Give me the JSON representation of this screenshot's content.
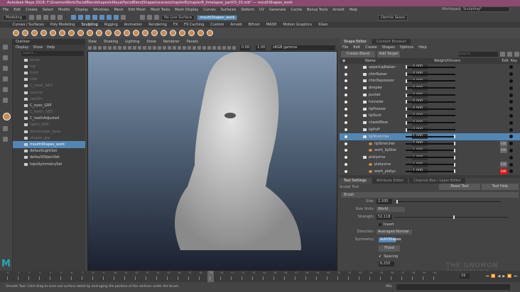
{
  "title": "Autodesk Maya 2018: F:\\GnomonWork\\FacialBlendshapesInMaya\\FacialBlendShapes\\scenes\\chapter8\\chapter8_timelapse_part03_03.mb* --- mouthShapes_work",
  "menu": [
    "File",
    "Edit",
    "Create",
    "Select",
    "Modify",
    "Display",
    "Windows",
    "Mesh",
    "Edit Mesh",
    "Mesh Tools",
    "Mesh Display",
    "Curves",
    "Surfaces",
    "Deform",
    "UV",
    "Generate",
    "Cache",
    "Bonus Tools",
    "Arnold",
    "Help"
  ],
  "toolbar": {
    "mode": "Modeling",
    "live_surface": "No Live Surface",
    "object": "mouthShapes_work",
    "user": "Derrick Sesso",
    "workspace_label": "Workspace :",
    "workspace": "Sculpting*"
  },
  "shelf_tabs": [
    "Curves / Surfaces",
    "Poly Modeling",
    "Sculpting",
    "Rigging",
    "Animation",
    "Rendering",
    "FX",
    "FX Caching",
    "Custom",
    "Arnold",
    "Bifrost",
    "MASH",
    "Motion Graphics",
    "XGen"
  ],
  "shelf_active": "Sculpting",
  "outliner": {
    "title": "Outliner",
    "menu": [
      "Display",
      "Show",
      "Help"
    ],
    "search_placeholder": "Search...",
    "items": [
      {
        "name": "persp",
        "dim": true
      },
      {
        "name": "top",
        "dim": true
      },
      {
        "name": "front",
        "dim": true
      },
      {
        "name": "side",
        "dim": true
      },
      {
        "name": "C_head_GEO",
        "dim": true
      },
      {
        "name": "neutral",
        "dim": true
      },
      {
        "name": "sasUVs",
        "dim": true
      },
      {
        "name": "C_eyes_GRP",
        "dim": false
      },
      {
        "name": "C_teeth_GEO",
        "dim": true
      },
      {
        "name": "C_teethAdjusted",
        "dim": false
      },
      {
        "name": "lights_GRP",
        "dim": true
      },
      {
        "name": "blendshape_base",
        "dim": true
      },
      {
        "name": "shapes_grp",
        "dim": true
      },
      {
        "name": "mouthShapes_work",
        "dim": false,
        "selected": true
      },
      {
        "name": "defaultLightSet",
        "dim": false
      },
      {
        "name": "defaultObjectSet",
        "dim": false
      },
      {
        "name": "topoSymmetrySet",
        "dim": false
      }
    ]
  },
  "viewport": {
    "menu": [
      "View",
      "Shading",
      "Lighting",
      "Show",
      "Renderer",
      "Panels"
    ],
    "exposure": "0.00",
    "gamma": "1.00",
    "colorspace": "sRGB gamma"
  },
  "shape_editor": {
    "tabs": [
      "Shape Editor",
      "Content Browser"
    ],
    "menu": [
      "File",
      "Edit",
      "Create",
      "Shapes",
      "Options",
      "Help"
    ],
    "create_blend_shape": "Create Blend Shape",
    "add_target": "Add Target",
    "search_placeholder": "Search...",
    "col_name": "Name",
    "col_weight": "Weight/Drivers",
    "col_edit": "Edit",
    "col_key": "Key",
    "edit_label": "Edit",
    "rows": [
      {
        "name": "upperLipRaiser",
        "value": "0.000",
        "weight": 0,
        "type": "folder"
      },
      {
        "name": "chinRaiser",
        "value": "0.000",
        "weight": 0,
        "type": "folder"
      },
      {
        "name": "chinDepressor",
        "value": "0.000",
        "weight": 0,
        "type": "folder"
      },
      {
        "name": "dimpler",
        "value": "0.000",
        "weight": 0,
        "type": "folder"
      },
      {
        "name": "pucker",
        "value": "0.000",
        "weight": 0,
        "type": "folder"
      },
      {
        "name": "funneler",
        "value": "0.000",
        "weight": 0,
        "type": "folder"
      },
      {
        "name": "lipPressor",
        "value": "0.000",
        "weight": 0,
        "type": "folder"
      },
      {
        "name": "lipSuck",
        "value": "0.000",
        "weight": 0,
        "type": "folder"
      },
      {
        "name": "cheekBlow",
        "value": "0.000",
        "weight": 0,
        "type": "folder"
      },
      {
        "name": "lipPuff",
        "value": "0.000",
        "weight": 0,
        "type": "folder"
      },
      {
        "name": "lipStretcher",
        "value": "1.000",
        "weight": 1,
        "type": "folder",
        "selected": true
      },
      {
        "name": "lipStretcher",
        "value": "1.000",
        "weight": 1,
        "type": "target",
        "edit": "grey"
      },
      {
        "name": "work_lipStre",
        "value": "1.000",
        "weight": 1,
        "type": "target",
        "edit": "grey"
      },
      {
        "name": "platysma",
        "value": "1.000",
        "weight": 1,
        "type": "folder"
      },
      {
        "name": "platysma",
        "value": "1.000",
        "weight": 1,
        "type": "target",
        "edit": "grey"
      },
      {
        "name": "work_platys",
        "value": "1.000",
        "weight": 1,
        "type": "target",
        "edit": "red"
      }
    ]
  },
  "tool_settings": {
    "tabs": [
      "Tool Settings",
      "Attribute Editor",
      "Channel Box / Layer Editor"
    ],
    "tool_name": "Sculpt Tool",
    "reset": "Reset Tool",
    "help": "Tool Help",
    "section": "Brush",
    "size_label": "Size:",
    "size": "2.100",
    "size_frac": 0.02,
    "units_label": "Size Units:",
    "units": "World",
    "strength_label": "Strength:",
    "strength": "52.118",
    "strength_frac": 0.52,
    "invert": "Invert",
    "direction_label": "Direction:",
    "direction": "Averaged Normal",
    "symmetry_label": "Symmetry:",
    "symmetry": "outhShapes",
    "flood": "Flood",
    "spacing": "Spacing",
    "spacing_value": "6.250"
  },
  "timeline": {
    "ticks": [
      "0",
      "1",
      "2",
      "3",
      "4",
      "5",
      "6",
      "7",
      "8",
      "9",
      "10",
      "11",
      "12",
      "13",
      "14",
      "15",
      "16",
      "17",
      "18",
      "19",
      "20",
      "21",
      "22",
      "23",
      "24",
      "25",
      "26",
      "27",
      "28",
      "29",
      "30",
      "31",
      "32",
      "33",
      "34",
      "35",
      "36",
      "37",
      "38",
      "39",
      "40"
    ],
    "current": "19",
    "current_field": "19"
  },
  "command_label": "MEL",
  "status": "Smooth Tool: Click-drag to even out surface detail by averaging the position of the vertices under the brush.",
  "watermark": "THE GNOMON WORKSHOP",
  "colors": {
    "titlebar": "#8b4a6f",
    "selection": "#5286b5",
    "edit_red": "#e01515"
  }
}
